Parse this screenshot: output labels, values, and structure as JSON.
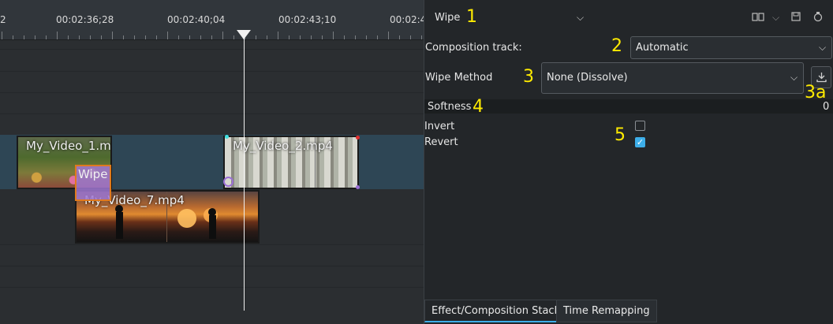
{
  "timeline": {
    "ruler_labels": [
      "2",
      "00:02:36;28",
      "00:02:40;04",
      "00:02:43;10",
      "00:02:4"
    ],
    "clips": {
      "video1": "My_Video_1.m",
      "video2": "My_Video_2.mp4",
      "video7": "My_Video_7.mp4",
      "wipe": "Wipe"
    }
  },
  "panel": {
    "effect_name": "Wipe",
    "composition_track": {
      "label": "Composition track:",
      "value": "Automatic"
    },
    "wipe_method": {
      "label": "Wipe Method",
      "value": "None (Dissolve)"
    },
    "softness": {
      "label": "Softness",
      "value": "0"
    },
    "invert": {
      "label": "Invert",
      "checked": false
    },
    "revert": {
      "label": "Revert",
      "checked": true
    }
  },
  "annotations": {
    "n1": "1",
    "n2": "2",
    "n3": "3",
    "n3a": "3a",
    "n4": "4",
    "n5": "5"
  },
  "tabs": [
    "Effect/Composition Stack",
    "Time Remapping"
  ],
  "icons": {
    "header": [
      "compare-icon",
      "chevron-down-icon",
      "save-icon",
      "reset-icon"
    ],
    "download": "download-icon"
  },
  "colors": {
    "accent": "#3daee9",
    "annotation": "#ffeb00",
    "wipe_border": "#e07a1e",
    "wipe_fill": "#a078d2"
  }
}
